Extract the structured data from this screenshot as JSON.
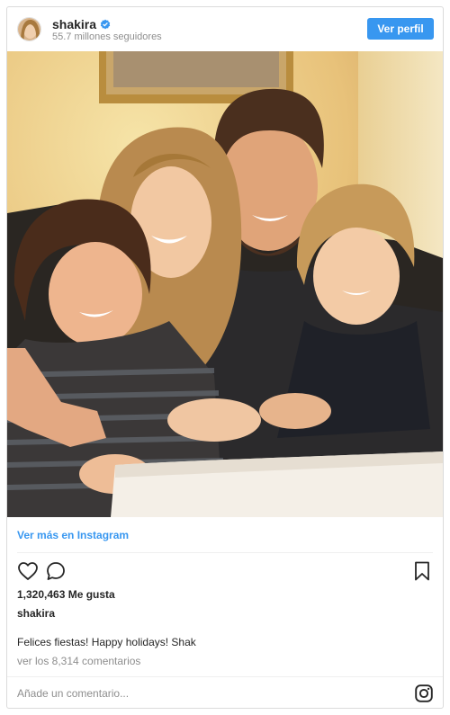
{
  "header": {
    "username": "shakira",
    "followers": "55.7 millones seguidores",
    "follow_label": "Ver perfil"
  },
  "post": {
    "view_more": "Ver más en Instagram",
    "likes": "1,320,463 Me gusta",
    "caption_user": "shakira",
    "caption": "Felices fiestas! Happy holidays! Shak",
    "comments": "ver los 8,314 comentarios",
    "comment_placeholder": "Añade un comentario..."
  },
  "icons": {
    "avatar": "avatar",
    "verified": "verified-badge-icon",
    "like": "heart-icon",
    "comment": "comment-icon",
    "save": "bookmark-icon",
    "instagram": "instagram-logo-icon"
  },
  "colors": {
    "accent": "#3897f0",
    "secondary_text": "#8e8e8e",
    "primary_text": "#262626",
    "border": "#dbdbdb"
  }
}
